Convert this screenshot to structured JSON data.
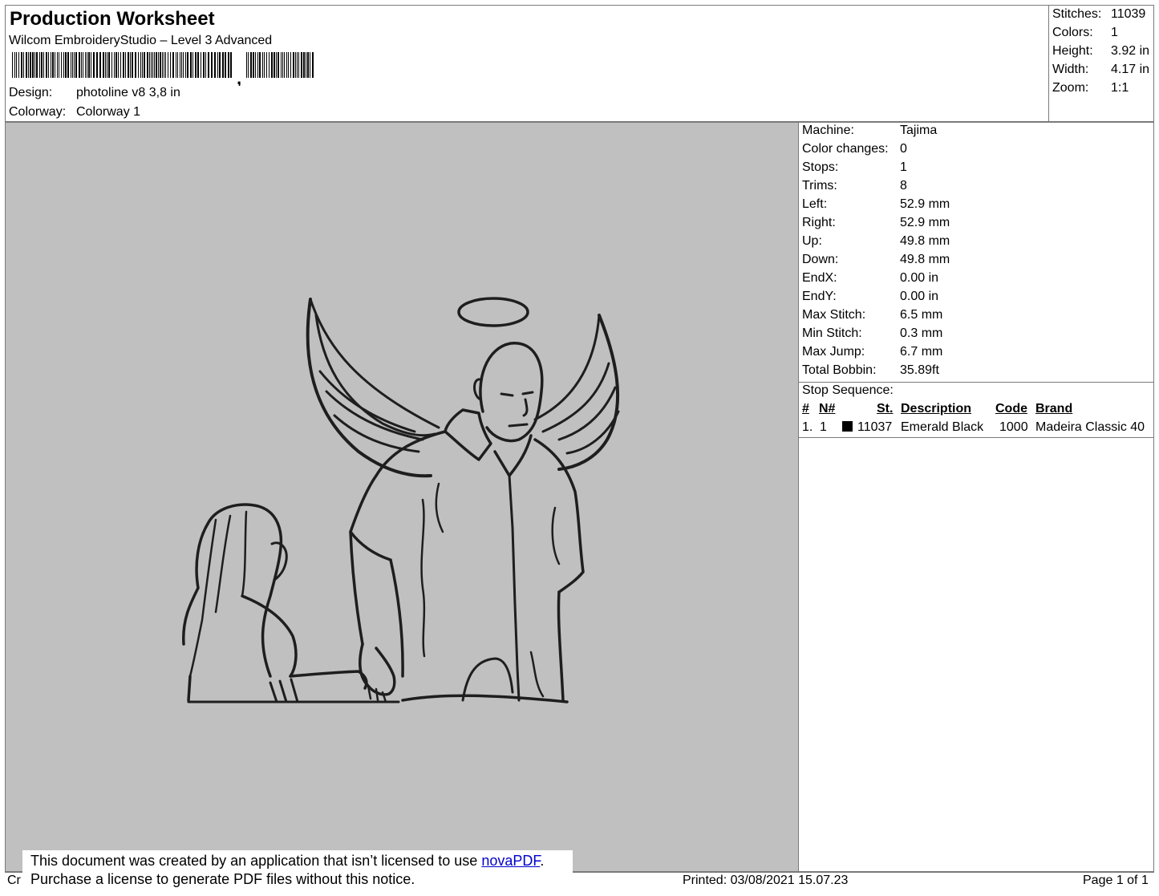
{
  "header": {
    "title": "Production Worksheet",
    "subtitle": "Wilcom EmbroideryStudio – Level 3 Advanced",
    "barcode_suffix": ",",
    "design_label": "Design:",
    "design_value": "photoline v8 3,8 in",
    "colorway_label": "Colorway:",
    "colorway_value": "Colorway 1"
  },
  "summary": [
    {
      "label": "Stitches:",
      "value": "11039"
    },
    {
      "label": "Colors:",
      "value": "1"
    },
    {
      "label": "Height:",
      "value": "3.92 in"
    },
    {
      "label": "Width:",
      "value": "4.17 in"
    },
    {
      "label": "Zoom:",
      "value": "1:1"
    }
  ],
  "machine_info": [
    {
      "label": "Machine:",
      "value": "Tajima"
    },
    {
      "label": "Color changes:",
      "value": "0"
    },
    {
      "label": "Stops:",
      "value": "1"
    },
    {
      "label": "Trims:",
      "value": "8"
    },
    {
      "label": "Left:",
      "value": "52.9 mm"
    },
    {
      "label": "Right:",
      "value": "52.9 mm"
    },
    {
      "label": "Up:",
      "value": "49.8 mm"
    },
    {
      "label": "Down:",
      "value": "49.8 mm"
    },
    {
      "label": "EndX:",
      "value": "0.00 in"
    },
    {
      "label": "EndY:",
      "value": "0.00 in"
    },
    {
      "label": "Max Stitch:",
      "value": "6.5 mm"
    },
    {
      "label": "Min Stitch:",
      "value": "0.3 mm"
    },
    {
      "label": "Max Jump:",
      "value": "6.7 mm"
    },
    {
      "label": "Total Bobbin:",
      "value": "35.89ft"
    }
  ],
  "stop_sequence": {
    "title": "Stop Sequence:",
    "columns": {
      "index": "#",
      "needle": "N#",
      "stitches": "St.",
      "description": "Description",
      "code": "Code",
      "brand": "Brand"
    },
    "rows": [
      {
        "index": "1.",
        "needle": "1",
        "swatch_color": "#000000",
        "stitches": "11037",
        "description": "Emerald Black",
        "code": "1000",
        "brand": "Madeira Classic 40"
      }
    ]
  },
  "colors": {
    "canvas_bg": "#c0c0c0",
    "thread": "#1e1e1e",
    "border": "#7a7a7a",
    "link": "#0000cc"
  },
  "footer": {
    "left_fragment": "Cr",
    "printed": "Printed: 03/08/2021 15.07.23",
    "page": "Page 1 of 1"
  },
  "notice": {
    "line1_prefix": "This document was created by an application that isn’t licensed to use ",
    "link_text": "novaPDF",
    "line1_suffix": ".",
    "line2": "Purchase a license to generate PDF files without this notice."
  }
}
